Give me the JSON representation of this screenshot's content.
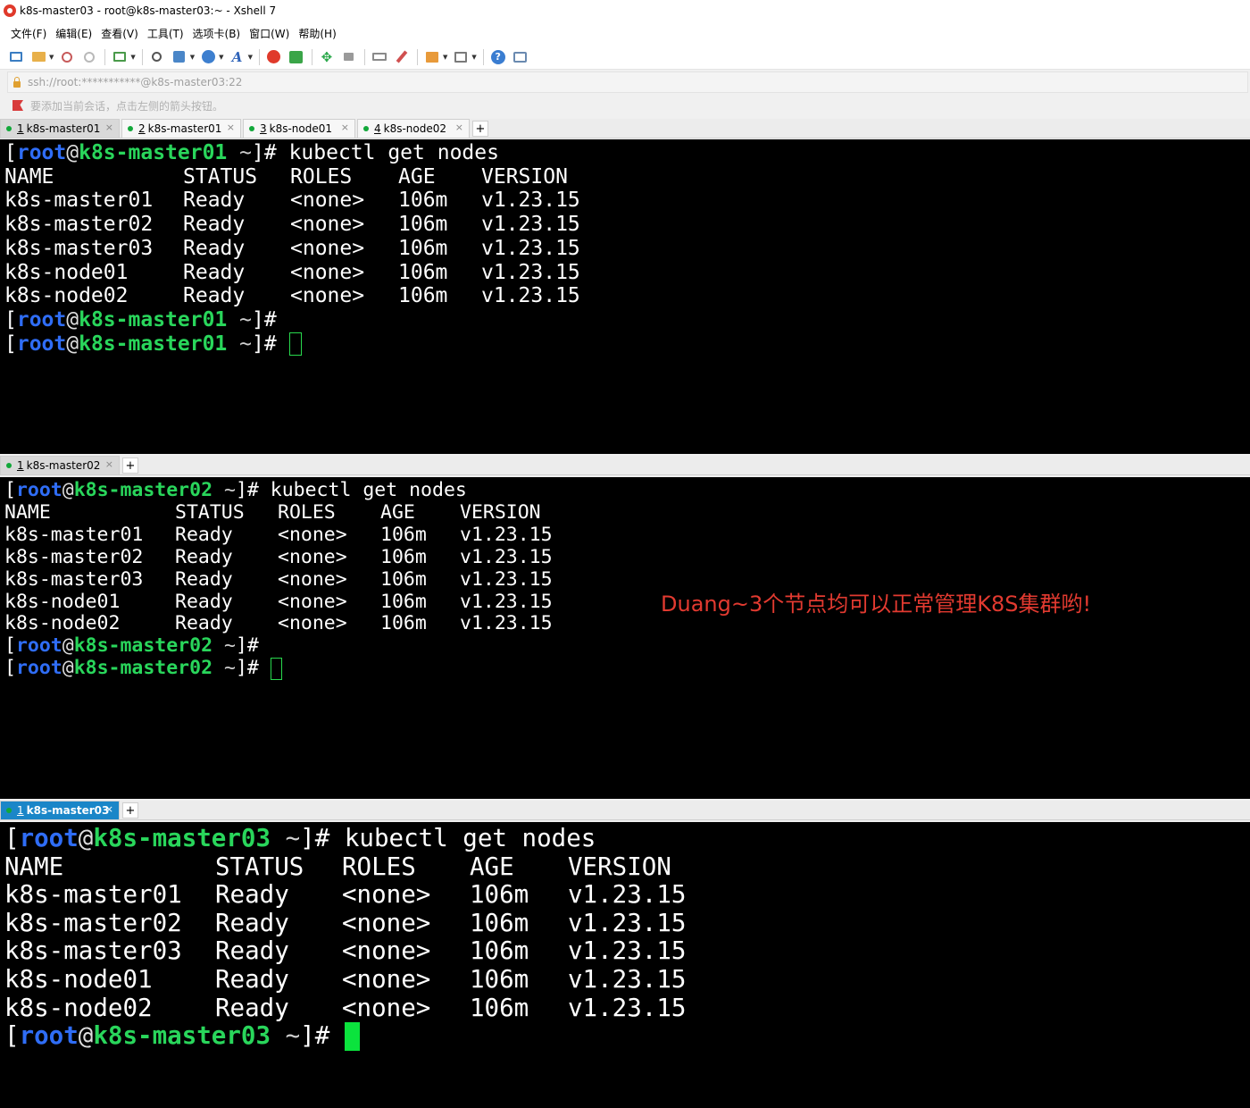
{
  "window": {
    "title": "k8s-master03 - root@k8s-master03:~ - Xshell 7"
  },
  "menu": [
    "文件(F)",
    "编辑(E)",
    "查看(V)",
    "工具(T)",
    "选项卡(B)",
    "窗口(W)",
    "帮助(H)"
  ],
  "toolbar": {
    "icons": [
      "new-session-icon",
      "open-folder-icon",
      "disconnect-icon",
      "reconnect-icon",
      "new-tab-icon",
      "find-icon",
      "transfer-icon",
      "globe-icon",
      "font-icon",
      "xftp-icon",
      "xmanager-icon",
      "fullscreen-icon",
      "lock-icon",
      "keyboard-icon",
      "highlight-icon",
      "compose-icon",
      "layout-icon",
      "help-icon",
      "chat-icon"
    ]
  },
  "address": {
    "text": "ssh://root:***********@k8s-master03:22"
  },
  "hint": {
    "text": "要添加当前会话，点击左侧的箭头按钮。"
  },
  "panes": [
    {
      "tabs": [
        {
          "num": "1",
          "label": "k8s-master01",
          "active": true
        },
        {
          "num": "2",
          "label": "k8s-master01",
          "active": false
        },
        {
          "num": "3",
          "label": "k8s-node01",
          "active": false
        },
        {
          "num": "4",
          "label": "k8s-node02",
          "active": false
        }
      ],
      "prompt": {
        "user": "root",
        "at": "@",
        "host": "k8s-master01",
        "tilde": "~",
        "suffix": "]#"
      },
      "command": "kubectl get nodes",
      "table": {
        "columns": [
          "NAME",
          "STATUS",
          "ROLES",
          "AGE",
          "VERSION"
        ],
        "rows": [
          [
            "k8s-master01",
            "Ready",
            "<none>",
            "106m",
            "v1.23.15"
          ],
          [
            "k8s-master02",
            "Ready",
            "<none>",
            "106m",
            "v1.23.15"
          ],
          [
            "k8s-master03",
            "Ready",
            "<none>",
            "106m",
            "v1.23.15"
          ],
          [
            "k8s-node01",
            "Ready",
            "<none>",
            "106m",
            "v1.23.15"
          ],
          [
            "k8s-node02",
            "Ready",
            "<none>",
            "106m",
            "v1.23.15"
          ]
        ]
      },
      "trailing_prompts": 2,
      "cursor": "outline"
    },
    {
      "tabs": [
        {
          "num": "1",
          "label": "k8s-master02",
          "active": true
        }
      ],
      "prompt": {
        "user": "root",
        "at": "@",
        "host": "k8s-master02",
        "tilde": "~",
        "suffix": "]#"
      },
      "command": "kubectl get nodes",
      "table": {
        "columns": [
          "NAME",
          "STATUS",
          "ROLES",
          "AGE",
          "VERSION"
        ],
        "rows": [
          [
            "k8s-master01",
            "Ready",
            "<none>",
            "106m",
            "v1.23.15"
          ],
          [
            "k8s-master02",
            "Ready",
            "<none>",
            "106m",
            "v1.23.15"
          ],
          [
            "k8s-master03",
            "Ready",
            "<none>",
            "106m",
            "v1.23.15"
          ],
          [
            "k8s-node01",
            "Ready",
            "<none>",
            "106m",
            "v1.23.15"
          ],
          [
            "k8s-node02",
            "Ready",
            "<none>",
            "106m",
            "v1.23.15"
          ]
        ]
      },
      "trailing_prompts": 2,
      "cursor": "outline"
    },
    {
      "tabs": [
        {
          "num": "1",
          "label": "k8s-master03",
          "active": true
        }
      ],
      "prompt": {
        "user": "root",
        "at": "@",
        "host": "k8s-master03",
        "tilde": "~",
        "suffix": "]#"
      },
      "command": "kubectl get nodes",
      "table": {
        "columns": [
          "NAME",
          "STATUS",
          "ROLES",
          "AGE",
          "VERSION"
        ],
        "rows": [
          [
            "k8s-master01",
            "Ready",
            "<none>",
            "106m",
            "v1.23.15"
          ],
          [
            "k8s-master02",
            "Ready",
            "<none>",
            "106m",
            "v1.23.15"
          ],
          [
            "k8s-master03",
            "Ready",
            "<none>",
            "106m",
            "v1.23.15"
          ],
          [
            "k8s-node01",
            "Ready",
            "<none>",
            "106m",
            "v1.23.15"
          ],
          [
            "k8s-node02",
            "Ready",
            "<none>",
            "106m",
            "v1.23.15"
          ]
        ]
      },
      "trailing_prompts": 1,
      "cursor": "solid"
    }
  ],
  "annotation": {
    "text": "Duang~3个节点均可以正常管理K8S集群哟!"
  },
  "colors": {
    "user": "#2f6df6",
    "host": "#29d65b",
    "cursor": "#0be33d",
    "annotation": "#e23a30",
    "terminal_bg": "#000000"
  }
}
